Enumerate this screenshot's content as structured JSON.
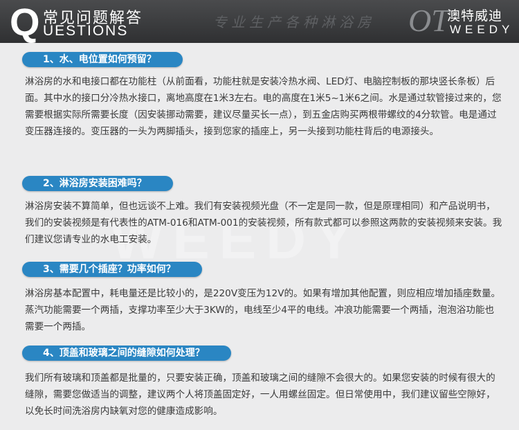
{
  "header": {
    "q_letter": "Q",
    "title": "常见问题解答",
    "subtitle": "UESTIONS",
    "slogan": "专业生产各种淋浴房",
    "logo_ot": "OT",
    "logo_cn": "澳特威迪",
    "logo_en": "WEEDY"
  },
  "watermark": "WEEDY",
  "faqs": [
    {
      "question": "1、水、电位置如何预留？",
      "answer": "淋浴房的水和电接口都在功能柱（从前面看，功能柱就是安装冷热水阀、LED灯、电脑控制板的那块竖长条板）后面。其中水的接口分冷热水接口，离地高度在1米3左右。电的高度在1米5~1米6之间。水是通过软管接过来的，您需要根据实际所需要长度（因安装挪动需要，建议尽量买长一点），到五金店购买两根带螺纹的4分软管。电是通过变压器连接的。变压器的一头为两脚插头，接到您家的插座上，另一头接到功能柱背后的电源接头。"
    },
    {
      "question": "2、淋浴房安装困难吗？",
      "answer": "淋浴房安装不算简单，但也远谈不上难。我们有安装视频光盘（不一定是同一款，但是原理相同）和产品说明书，我们的安装视频是有代表性的ATM-016和ATM-001的安装视频，所有款式都可以参照这两款的安装视频来安装。我们建议您请专业的水电工安装。"
    },
    {
      "question": "3、需要几个插座？功率如何？",
      "answer": "淋浴房基本配置中，耗电量还是比较小的，是220V变压为12V的。如果有增加其他配置，则应相应增加插座数量。蒸汽功能需要一个两插，支撑功率至少大于3KW的，电线至少4平的电线。冲浪功能需要一个两插，泡泡浴功能也需要一个两插。"
    },
    {
      "question": "4、顶盖和玻璃之间的缝隙如何处理？",
      "answer": "我们所有玻璃和顶盖都是批量的，只要安装正确，顶盖和玻璃之间的缝隙不会很大的。如果您安装的时候有很大的缝隙，需要您做适当的调整，建议两个人将顶盖固定好，一人用螺丝固定。但日常使用中，我们建议留些空隙好，以免长时间洗浴房内缺氧对您的健康造成影响。"
    }
  ]
}
